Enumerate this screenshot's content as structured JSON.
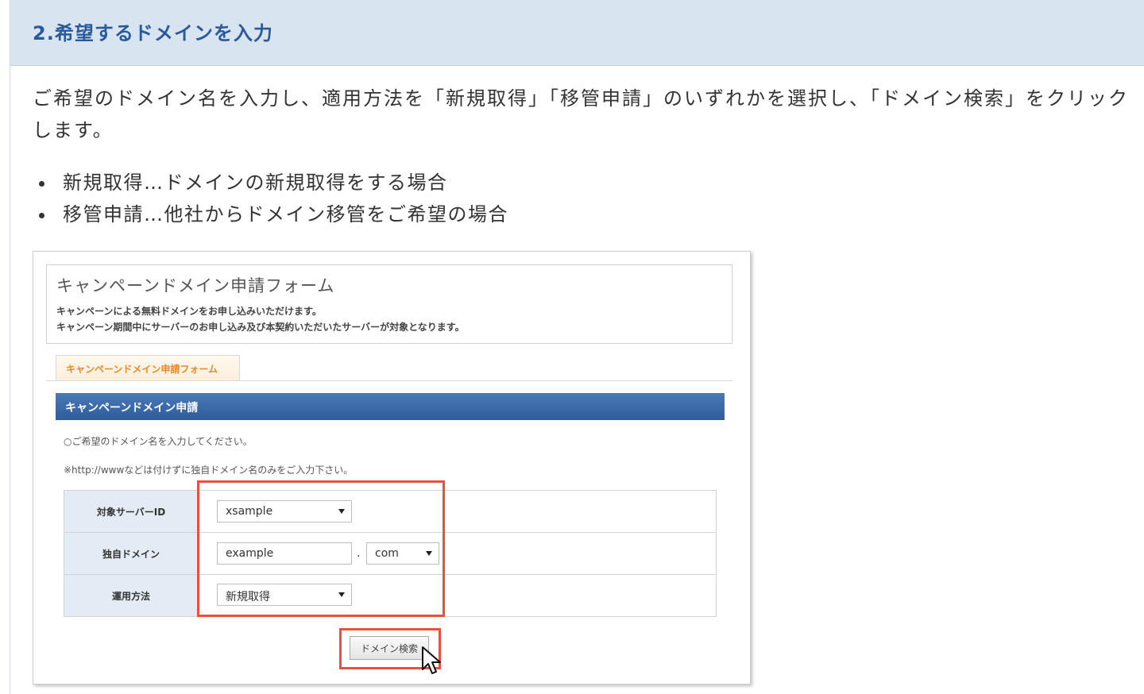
{
  "section": {
    "title": "2.希望するドメインを入力"
  },
  "intro": "ご希望のドメイン名を入力し、適用方法を「新規取得」「移管申請」のいずれかを選択し、「ドメイン検索」をクリックします。",
  "bullets": [
    "新規取得…ドメインの新規取得をする場合",
    "移管申請…他社からドメイン移管をご希望の場合"
  ],
  "figure": {
    "form_title": "キャンペーンドメイン申請フォーム",
    "form_desc_1": "キャンペーンによる無料ドメインをお申し込みいただけます。",
    "form_desc_2": "キャンペーン期間中にサーバーのお申し込み及び本契約いただいたサーバーが対象となります。",
    "tab_label": "キャンペーンドメイン申請フォーム",
    "bar_label": "キャンペーンドメイン申請",
    "note_1": "○ご希望のドメイン名を入力してください。",
    "note_2": "※http://wwwなどは付けずに独自ドメイン名のみをご入力下さい。",
    "rows": [
      {
        "label": "対象サーバーID",
        "value": "xsample"
      },
      {
        "label": "独自ドメイン",
        "value": "example",
        "tld": "com",
        "separator": "."
      },
      {
        "label": "運用方法",
        "value": "新規取得"
      }
    ],
    "search_button": "ドメイン検索",
    "highlight_color": "#e5533c"
  }
}
